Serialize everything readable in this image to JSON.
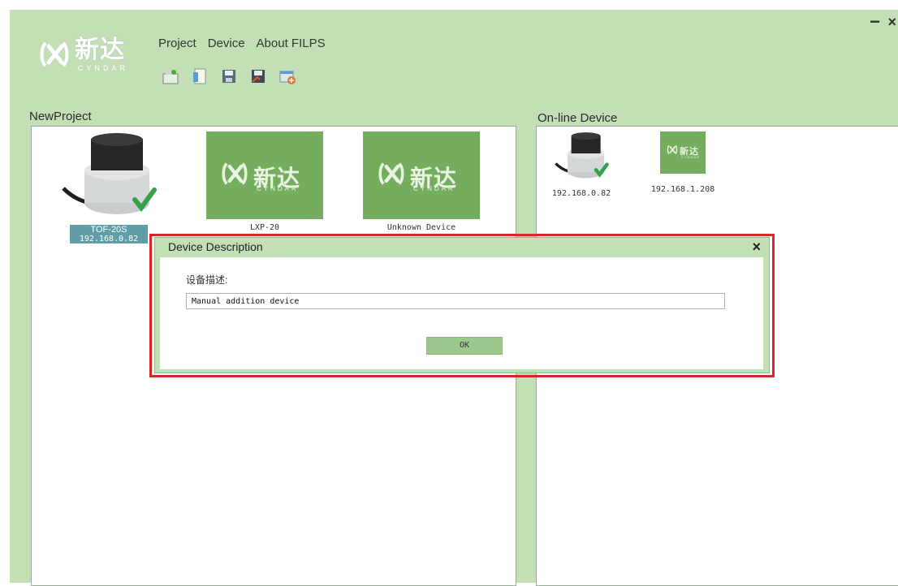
{
  "window": {
    "minimize_glyph": "−",
    "close_glyph": "×"
  },
  "logo": {
    "name_cn": "新达",
    "name_en": "CYNDAR"
  },
  "menu": {
    "items": [
      "Project",
      "Device",
      "About FILPS"
    ]
  },
  "toolbar": {
    "icons": [
      "new-project-icon",
      "open-file-icon",
      "save-icon",
      "save-as-icon",
      "add-device-icon"
    ]
  },
  "project_panel": {
    "title": "NewProject",
    "devices": [
      {
        "name": "TOF-20S",
        "ip": "192.168.0.82",
        "icon": "lidar-sensor-image",
        "status": "connected"
      },
      {
        "name": "LXP-20",
        "icon": "cyndar-logo-tile"
      },
      {
        "name": "Unknown Device",
        "icon": "cyndar-logo-tile"
      }
    ]
  },
  "online_panel": {
    "title": "On-line Device",
    "devices": [
      {
        "ip": "192.168.0.82",
        "icon": "lidar-sensor-image"
      },
      {
        "ip": "192.168.1.208",
        "icon": "cyndar-logo-tile"
      }
    ]
  },
  "dialog": {
    "title": "Device Description",
    "close_glyph": "×",
    "field_label": "设备描述:",
    "field_value": "Manual addition device",
    "ok_label": "OK"
  },
  "colors": {
    "app_background": "#c2dfb6",
    "tile_green": "#74ad5e",
    "highlight_border": "#d8262a",
    "selection": "#5f9ea6"
  }
}
